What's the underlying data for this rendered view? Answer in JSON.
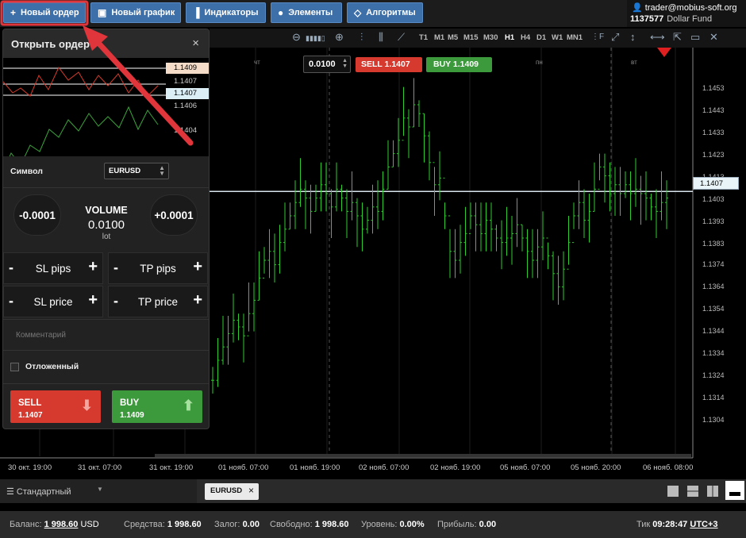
{
  "toolbar": {
    "new_order": "Новый ордер",
    "new_chart": "Новый график",
    "indicators": "Индикаторы",
    "elements": "Элементы",
    "algorithms": "Алгоритмы"
  },
  "account": {
    "user": "trader@mobius-soft.org",
    "number": "1137577",
    "fund": "Dollar Fund"
  },
  "chart_toolbar": {
    "timeframes": [
      "T1",
      "M1",
      "M5",
      "M15",
      "M30",
      "H1",
      "H4",
      "D1",
      "W1",
      "MN1"
    ],
    "selected": "H1"
  },
  "quote": {
    "lot": "0.0100",
    "sell": "SELL 1.1407",
    "buy": "BUY 1.1409"
  },
  "chart_data": {
    "type": "ohlc",
    "symbol": "EURUSD",
    "timeframe": "H1",
    "price_ticks": [
      "1.1453",
      "1.1443",
      "1.1433",
      "1.1423",
      "1.1413",
      "1.1403",
      "1.1393",
      "1.1383",
      "1.1374",
      "1.1364",
      "1.1354",
      "1.1344",
      "1.1334",
      "1.1324",
      "1.1314",
      "1.1304"
    ],
    "last_price": "1.1407",
    "x_labels": [
      "30 окт. 19:00",
      "31 окт. 07:00",
      "31 окт. 19:00",
      "01 нояб. 07:00",
      "01 нояб. 19:00",
      "02 нояб. 07:00",
      "02 нояб. 19:00",
      "05 нояб. 07:00",
      "05 нояб. 20:00",
      "06 нояб. 08:00"
    ],
    "day_labels": [
      "чт",
      "пн",
      "вт"
    ],
    "ylim": [
      1.1296,
      1.1461
    ]
  },
  "order_panel": {
    "title": "Открыть ордер",
    "close": "×",
    "mini_labels": {
      "ask": "1.1409",
      "mid": "1.1407",
      "bid": "1.1407",
      "low": "1.1406",
      "lower": "1.1404"
    },
    "symbol_label": "Символ",
    "symbol": "EURUSD",
    "minus": "-0.0001",
    "plus": "+0.0001",
    "volume_title": "VOLUME",
    "volume_value": "0.0100",
    "volume_unit": "lot",
    "sl_pips": "SL pips",
    "tp_pips": "TP pips",
    "sl_price": "SL price",
    "tp_price": "TP price",
    "minus_sign": "-",
    "plus_sign": "+",
    "comment_placeholder": "Комментарий",
    "pending": "Отложенный",
    "sell_label": "SELL",
    "sell_price": "1.1407",
    "buy_label": "BUY",
    "buy_price": "1.1409"
  },
  "tabbar": {
    "template": "Стандартный",
    "tab": "EURUSD",
    "tab_close": "×"
  },
  "status": {
    "balance_label": "Баланс:",
    "balance": "1 998.60",
    "currency": "USD",
    "equity_label": "Средства:",
    "equity": "1 998.60",
    "margin_label": "Залог:",
    "margin": "0.00",
    "free_label": "Свободно:",
    "free": "1 998.60",
    "level_label": "Уровень:",
    "level": "0.00%",
    "profit_label": "Прибыль:",
    "profit": "0.00",
    "tick_label": "Тик",
    "time": "09:28:47",
    "tz": "UTC+3"
  },
  "colors": {
    "accent": "#3d6fa8",
    "sell": "#d63a2f",
    "buy": "#3d9a3c",
    "bar": "#2ecc2e",
    "highlight": "#e0353b"
  }
}
